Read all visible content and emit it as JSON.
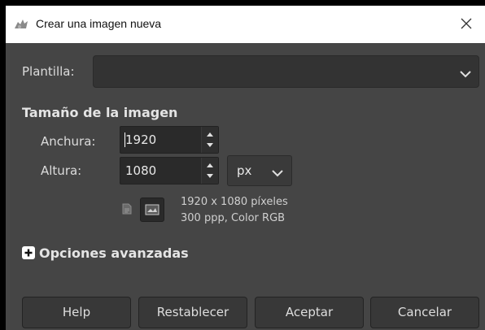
{
  "window": {
    "title": "Crear una imagen nueva",
    "icons": {
      "app": "gimp-wilber-icon",
      "close": "close-icon"
    }
  },
  "template": {
    "label": "Plantilla:",
    "value": ""
  },
  "image_size": {
    "heading": "Tamaño de la imagen",
    "width_label": "Anchura:",
    "width_value": "1920",
    "height_label": "Altura:",
    "height_value": "1080",
    "unit": "px",
    "info_line1": "1920 x 1080 píxeles",
    "info_line2": "300 ppp, Color RGB",
    "icons": [
      "portrait-icon",
      "landscape-icon"
    ]
  },
  "advanced": {
    "label": "Opciones avanzadas"
  },
  "buttons": {
    "help": "Help",
    "reset": "Restablecer",
    "ok": "Aceptar",
    "cancel": "Cancelar"
  },
  "colors": {
    "dialog_bg": "#454545",
    "field_bg": "#2a2a2a",
    "text": "#dcdcdc"
  }
}
